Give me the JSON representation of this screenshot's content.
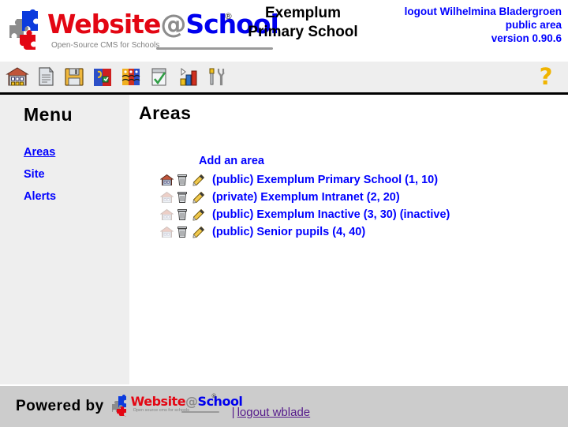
{
  "header": {
    "logo": {
      "word_part1": "Website",
      "word_at": "@",
      "word_part2": "School",
      "registered": "®",
      "tagline": "Open-Source CMS for Schools"
    },
    "school_name_line1": "Exemplum",
    "school_name_line2": "Primary School",
    "logout_user": "logout Wilhelmina Bladergroen",
    "area_label": "public area",
    "version": "version 0.90.6",
    "colors": {
      "link_blue": "#0000ff",
      "logo_red": "#e30613",
      "logo_blue": "#0000ee",
      "logo_gray": "#8c8c8c"
    }
  },
  "toolbar": {
    "items": [
      {
        "icon": "school-building-icon",
        "title": "Home"
      },
      {
        "icon": "page-document-icon",
        "title": "Pages"
      },
      {
        "icon": "floppy-disk-icon",
        "title": "Save"
      },
      {
        "icon": "modules-puzzle-icon",
        "title": "Modules"
      },
      {
        "icon": "users-faces-icon",
        "title": "Users"
      },
      {
        "icon": "checklist-clipboard-icon",
        "title": "Tasks"
      },
      {
        "icon": "bar-chart-statistics-icon",
        "title": "Statistics"
      },
      {
        "icon": "tools-wrench-screwdriver-icon",
        "title": "Tools"
      }
    ],
    "help": {
      "icon": "question-mark-help-icon",
      "label": "?"
    }
  },
  "sidebar": {
    "title": "Menu",
    "items": [
      {
        "label": "Areas",
        "active": true
      },
      {
        "label": "Site",
        "active": false
      },
      {
        "label": "Alerts",
        "active": false
      }
    ]
  },
  "main": {
    "page_title": "Areas",
    "add_area_label": "Add an area",
    "rows": [
      {
        "preview_icon": "home-preview-icon",
        "preview_enabled": true,
        "delete_icon": "trash-delete-icon",
        "edit_icon": "pencil-edit-icon",
        "label": "(public) Exemplum Primary School (1, 10)"
      },
      {
        "preview_icon": "home-preview-icon",
        "preview_enabled": false,
        "delete_icon": "trash-delete-icon",
        "edit_icon": "pencil-edit-icon",
        "label": "(private) Exemplum Intranet (2, 20)"
      },
      {
        "preview_icon": "home-preview-icon",
        "preview_enabled": false,
        "delete_icon": "trash-delete-icon",
        "edit_icon": "pencil-edit-icon",
        "label": "(public) Exemplum Inactive (3, 30) (inactive)"
      },
      {
        "preview_icon": "home-preview-icon",
        "preview_enabled": false,
        "delete_icon": "trash-delete-icon",
        "edit_icon": "pencil-edit-icon",
        "label": "(public) Senior pupils (4, 40)"
      }
    ]
  },
  "footer": {
    "powered_by": "Powered by",
    "logo": {
      "word_part1": "Website",
      "word_at": "@",
      "word_part2": "School",
      "registered": "®",
      "tagline": "Open source cms for schools"
    },
    "separator": "|",
    "logout_label": "logout wblade",
    "logout_color": "#551a8b"
  }
}
